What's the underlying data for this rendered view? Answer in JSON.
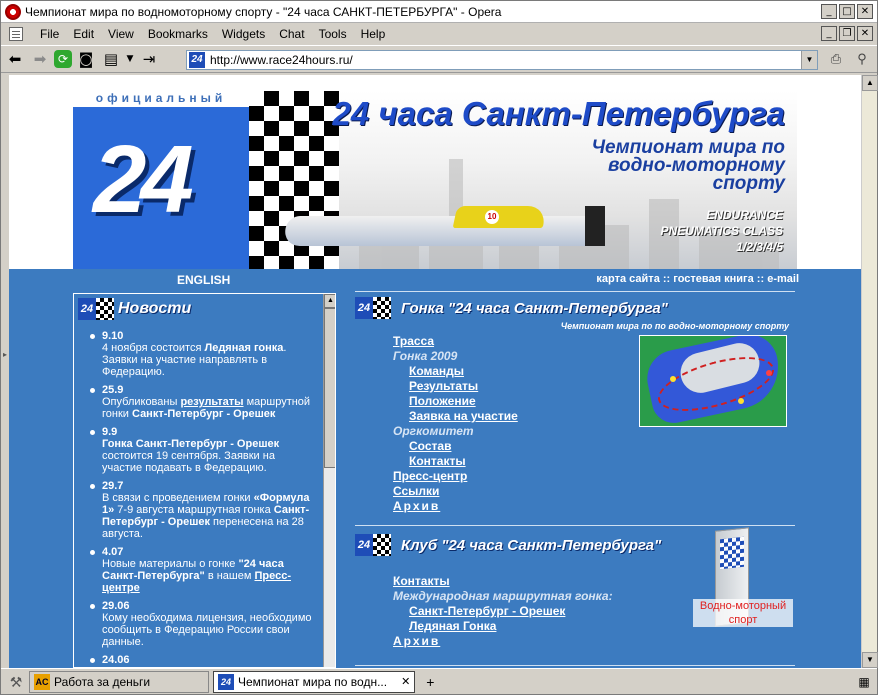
{
  "window": {
    "title": "Чемпионат мира по водномоторному спорту - \"24 часа САНКТ-ПЕТЕРБУРГА\" - Opera",
    "btn_min": "_",
    "btn_max": "□",
    "btn_close": "✕",
    "mdi_min": "_",
    "mdi_restore": "❐",
    "mdi_close": "✕"
  },
  "menu": [
    "File",
    "Edit",
    "View",
    "Bookmarks",
    "Widgets",
    "Chat",
    "Tools",
    "Help"
  ],
  "nav": {
    "url": "http://www.race24hours.ru/",
    "site_icon": "24",
    "dropdown_glyph": "▼"
  },
  "banner": {
    "official": "официальный сайт",
    "big_number": "24",
    "title": "24 часа Санкт-Петербурга",
    "subtitle_lines": [
      "Чемпионат мира по",
      "водно-моторному",
      "спорту"
    ],
    "class_lines": [
      "ENDURANCE",
      "PNEUMATICS CLASS",
      "1/2/3/4/5"
    ],
    "boat_number": "10"
  },
  "toprow": {
    "english": "ENGLISH",
    "links": [
      "карта сайта",
      "гостевая книга",
      "e-mail"
    ],
    "sep": " :: "
  },
  "news": {
    "logo": "24",
    "title": "Новости",
    "items": [
      {
        "date": "9.10",
        "html": "4 ноября состоится <b>Ледяная гонка</b>. Заявки на участие направлять в Федерацию."
      },
      {
        "date": "25.9",
        "html": "Опубликованы <a href=\"#\">результаты</a> маршрутной гонки <b>Санкт-Петербург - Орешек</b>"
      },
      {
        "date": "9.9",
        "html": "<b>Гонка Санкт-Петербург - Орешек</b> состоится 19 сентября. Заявки на участие подавать в Федерацию."
      },
      {
        "date": "29.7",
        "html": "В связи с проведением гонки <b>«Формула 1»</b> 7-9 августа маршрутная гонка <b>Санкт-Петербург - Орешек</b> перенесена на 28 августа."
      },
      {
        "date": "4.07",
        "html": "Новые материалы о гонке <b>\"24 часа Санкт-Петербурга\"</b> в нашем <a href=\"#\">Пресс-центре</a>"
      },
      {
        "date": "29.06",
        "html": "Кому необходима лицензия, необходимо сообщить в Федерацию России свои данные."
      },
      {
        "date": "24.06",
        "html": ""
      }
    ],
    "scroll_up": "▲",
    "scroll_down": "▼"
  },
  "race": {
    "logo": "24",
    "title": "Гонка \"24 часа Санкт-Петербурга\"",
    "subtitle": "Чемпионат мира по по водно-моторному спорту",
    "menu": [
      {
        "label": "Трасса",
        "kind": "link"
      },
      {
        "label": "Гонка 2009",
        "kind": "cat"
      },
      {
        "label": "Команды",
        "kind": "sub"
      },
      {
        "label": "Результаты",
        "kind": "sub"
      },
      {
        "label": "Положение",
        "kind": "sub"
      },
      {
        "label": "Заявка на участие",
        "kind": "sub"
      },
      {
        "label": "Оргкомитет",
        "kind": "cat"
      },
      {
        "label": "Состав",
        "kind": "sub"
      },
      {
        "label": "Контакты",
        "kind": "sub"
      },
      {
        "label": "Пресс-центр",
        "kind": "link"
      },
      {
        "label": "Ссылки",
        "kind": "link"
      },
      {
        "label": "Архив",
        "kind": "spaced"
      }
    ]
  },
  "club": {
    "logo": "24",
    "title": "Клуб \"24 часа Санкт-Петербурга\"",
    "menu": [
      {
        "label": "Контакты",
        "kind": "link"
      },
      {
        "label": "Международная маршрутная гонка:",
        "kind": "cat"
      },
      {
        "label": "Санкт-Петербург - Орешек",
        "kind": "sub"
      },
      {
        "label": "Ледяная Гонка",
        "kind": "sub"
      },
      {
        "label": "Архив",
        "kind": "spaced"
      }
    ],
    "book_label": "Водно-моторный спорт"
  },
  "taskbar": {
    "tasks": [
      {
        "icon": "AC",
        "label": "Работа за деньги",
        "active": false
      },
      {
        "icon": "24",
        "label": "Чемпионат мира по водн...",
        "active": true
      }
    ],
    "close_glyph": "✕",
    "plus_glyph": "+"
  },
  "colors": {
    "page_blue": "#3c7bc0",
    "title_blue": "#1e4bc8",
    "link_white": "#ffffff"
  }
}
